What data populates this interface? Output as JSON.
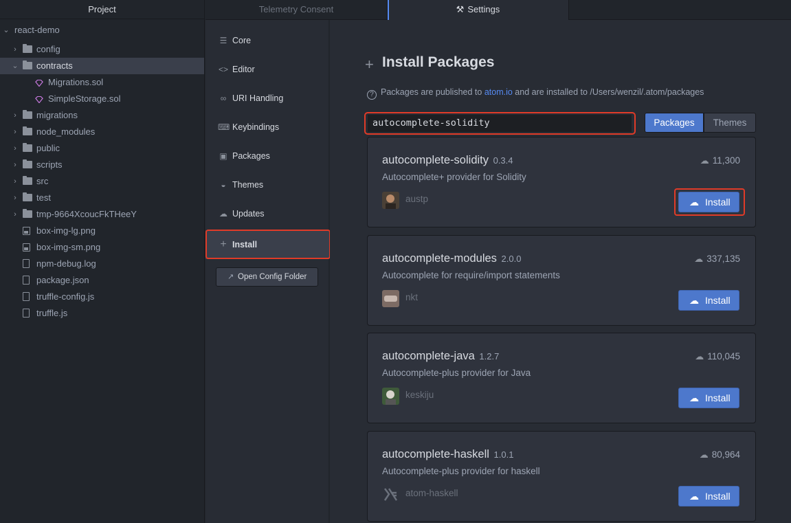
{
  "tree": {
    "header": "Project",
    "root": "react-demo",
    "items": [
      {
        "label": "config",
        "type": "folder",
        "expanded": false
      },
      {
        "label": "contracts",
        "type": "folder",
        "expanded": true
      },
      {
        "label": "Migrations.sol",
        "type": "sol"
      },
      {
        "label": "SimpleStorage.sol",
        "type": "sol"
      },
      {
        "label": "migrations",
        "type": "folder",
        "expanded": false
      },
      {
        "label": "node_modules",
        "type": "folder",
        "expanded": false
      },
      {
        "label": "public",
        "type": "folder",
        "expanded": false
      },
      {
        "label": "scripts",
        "type": "folder",
        "expanded": false
      },
      {
        "label": "src",
        "type": "folder",
        "expanded": false
      },
      {
        "label": "test",
        "type": "folder",
        "expanded": false
      },
      {
        "label": "tmp-9664XcoucFkTHeeY",
        "type": "folder",
        "expanded": false
      },
      {
        "label": "box-img-lg.png",
        "type": "image"
      },
      {
        "label": "box-img-sm.png",
        "type": "image"
      },
      {
        "label": "npm-debug.log",
        "type": "file"
      },
      {
        "label": "package.json",
        "type": "file"
      },
      {
        "label": "truffle-config.js",
        "type": "file"
      },
      {
        "label": "truffle.js",
        "type": "file"
      }
    ]
  },
  "tabs": [
    {
      "label": "Telemetry Consent",
      "active": false
    },
    {
      "label": "Settings",
      "active": true,
      "icon": "tools-icon"
    }
  ],
  "menu": {
    "items": [
      {
        "label": "Core",
        "icon": "sliders-icon",
        "active": false
      },
      {
        "label": "Editor",
        "icon": "code-icon",
        "active": false
      },
      {
        "label": "URI Handling",
        "icon": "link-icon",
        "active": false
      },
      {
        "label": "Keybindings",
        "icon": "keyboard-icon",
        "active": false
      },
      {
        "label": "Packages",
        "icon": "package-icon",
        "active": false
      },
      {
        "label": "Themes",
        "icon": "paintcan-icon",
        "active": false
      },
      {
        "label": "Updates",
        "icon": "cloud-download-icon",
        "active": false
      },
      {
        "label": "Install",
        "icon": "plus-icon",
        "active": true
      }
    ],
    "config_button": "Open Config Folder"
  },
  "install": {
    "title": "Install Packages",
    "info_prefix": "Packages are published to",
    "info_link": "atom.io",
    "info_suffix": "and are installed to /Users/wenzil/.atom/packages",
    "search_value": "autocomplete-solidity",
    "toggle_packages": "Packages",
    "toggle_themes": "Themes",
    "results": [
      {
        "name": "autocomplete-solidity",
        "version": "0.3.4",
        "description": "Autocomplete+ provider for Solidity",
        "owner": "austp",
        "downloads": "11,300",
        "button": "Install"
      },
      {
        "name": "autocomplete-modules",
        "version": "2.0.0",
        "description": "Autocomplete for require/import statements",
        "owner": "nkt",
        "downloads": "337,135",
        "button": "Install"
      },
      {
        "name": "autocomplete-java",
        "version": "1.2.7",
        "description": "Autocomplete-plus provider for Java",
        "owner": "keskiju",
        "downloads": "110,045",
        "button": "Install"
      },
      {
        "name": "autocomplete-haskell",
        "version": "1.0.1",
        "description": "Autocomplete-plus provider for haskell",
        "owner": "atom-haskell",
        "downloads": "80,964",
        "button": "Install"
      }
    ]
  },
  "colors": {
    "accent": "#568af2",
    "button": "#4d78cc",
    "highlight": "#e13b28"
  }
}
